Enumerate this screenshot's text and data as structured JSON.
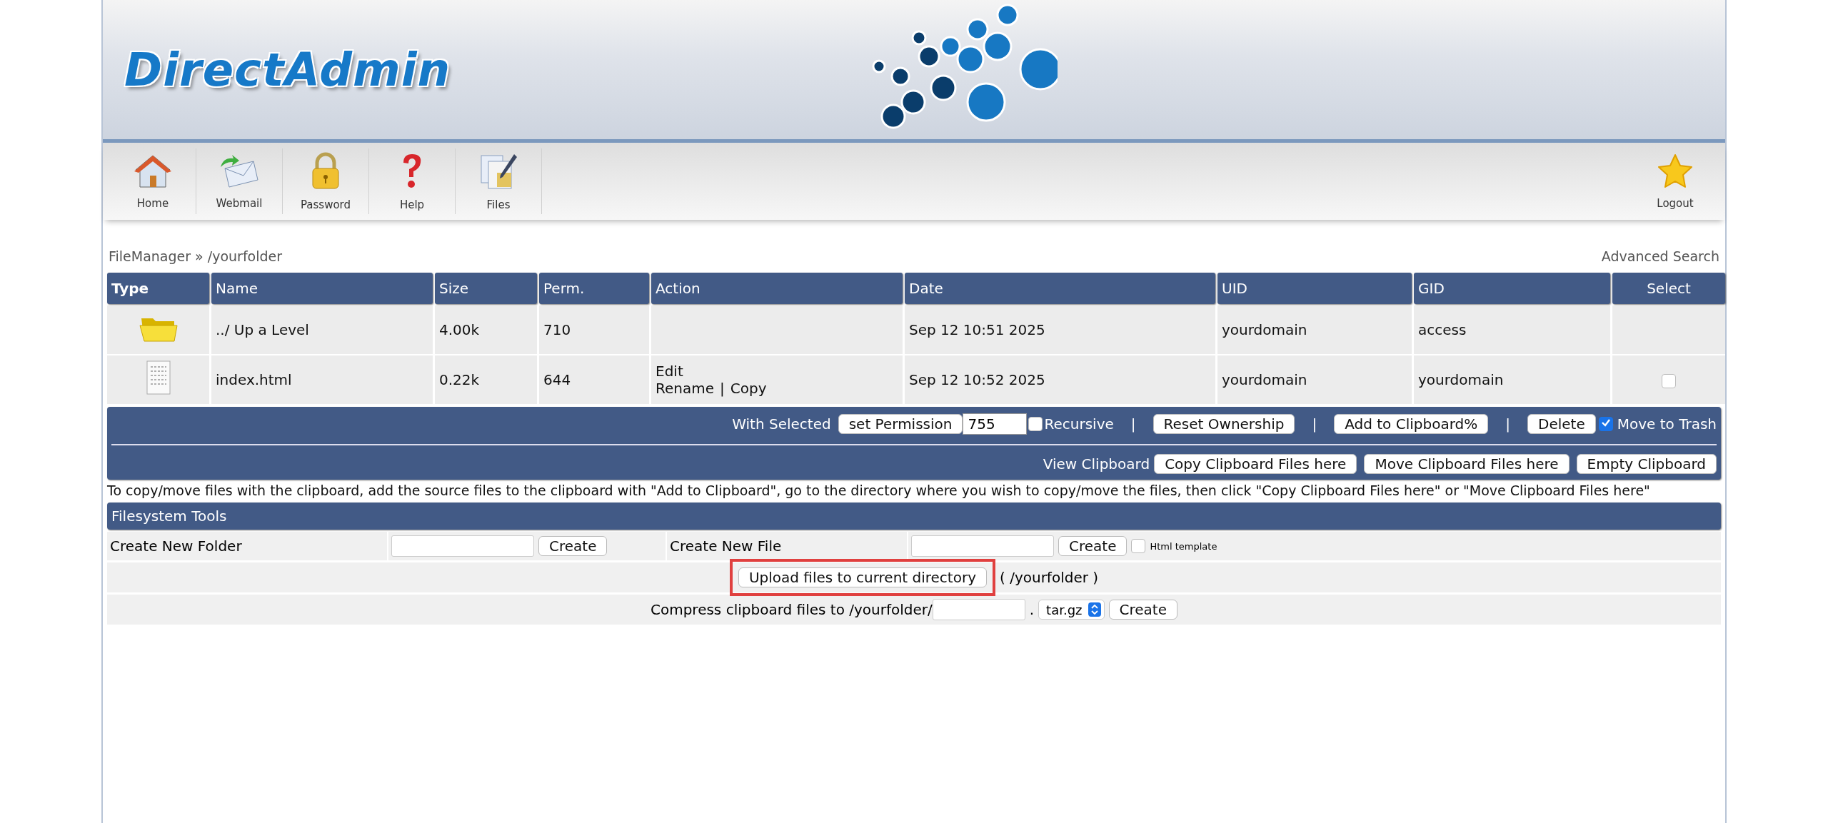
{
  "logo": "DirectAdmin",
  "nav": [
    {
      "label": "Home",
      "kind": "home"
    },
    {
      "label": "Webmail",
      "kind": "mail"
    },
    {
      "label": "Password",
      "kind": "lock"
    },
    {
      "label": "Help",
      "kind": "help"
    },
    {
      "label": "Files",
      "kind": "files"
    }
  ],
  "logout": {
    "label": "Logout"
  },
  "breadcrumb": "FileManager » /yourfolder",
  "advanced_search": "Advanced Search",
  "table": {
    "columns": [
      "Type",
      "Name",
      "Size",
      "Perm.",
      "Action",
      "Date",
      "UID",
      "GID",
      "Select"
    ],
    "action_separator": "|",
    "rows": [
      {
        "kind": "folder",
        "name": "../ Up a Level",
        "size": "4.00k",
        "perm": "710",
        "actions": [],
        "date": "Sep 12 10:51 2025",
        "uid": "yourdomain",
        "gid": "access"
      },
      {
        "kind": "file",
        "name": "index.html",
        "size": "0.22k",
        "perm": "644",
        "actions": [
          [
            "Edit"
          ],
          [
            "Rename",
            "Copy"
          ]
        ],
        "date": "Sep 12 10:52 2025",
        "uid": "yourdomain",
        "gid": "yourdomain",
        "selected": false
      }
    ]
  },
  "with_selected": {
    "label": "With Selected",
    "set_permission": "set Permission",
    "permission_value": "755",
    "recursive": {
      "label": "Recursive",
      "checked": false
    },
    "separator": "|",
    "reset": "Reset Ownership",
    "add_clipboard": "Add to Clipboard%",
    "delete": "Delete",
    "move_to_trash": {
      "label": "Move to Trash",
      "checked": true
    }
  },
  "clipboard": {
    "label": "View Clipboard",
    "buttons": [
      "Copy Clipboard Files here",
      "Move Clipboard Files here",
      "Empty Clipboard"
    ]
  },
  "note": "To copy/move files with the clipboard, add the source files to the clipboard with \"Add to Clipboard\", go to the directory where you wish to copy/move the files, then click \"Copy Clipboard Files here\" or \"Move Clipboard Files here\"",
  "tools": {
    "title": "Filesystem Tools",
    "new_folder": {
      "label": "Create New Folder",
      "button": "Create"
    },
    "new_file": {
      "label": "Create New File",
      "button": "Create",
      "template": {
        "label": "Html template",
        "checked": false
      }
    },
    "upload": {
      "button": "Upload files to current directory",
      "path": "( /yourfolder )",
      "highlighted": true
    },
    "compress": {
      "label": "Compress clipboard files to /yourfolder/",
      "dot": ".",
      "format": "tar.gz",
      "button": "Create"
    }
  }
}
